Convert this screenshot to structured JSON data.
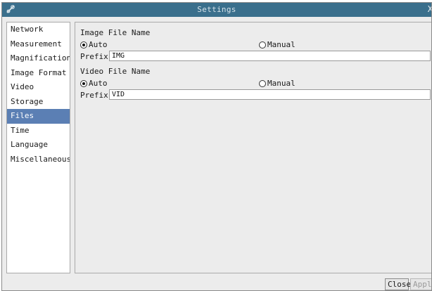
{
  "window": {
    "title": "Settings",
    "app_icon": "tools-icon",
    "close_glyph": "X"
  },
  "sidebar": {
    "items": [
      {
        "label": "Network",
        "active": false
      },
      {
        "label": "Measurement",
        "active": false
      },
      {
        "label": "Magnification",
        "active": false
      },
      {
        "label": "Image Format",
        "active": false
      },
      {
        "label": "Video",
        "active": false
      },
      {
        "label": "Storage",
        "active": false
      },
      {
        "label": "Files",
        "active": true
      },
      {
        "label": "Time",
        "active": false
      },
      {
        "label": "Language",
        "active": false
      },
      {
        "label": "Miscellaneous",
        "active": false
      }
    ]
  },
  "image_file": {
    "heading": "Image File Name",
    "auto_label": "Auto",
    "manual_label": "Manual",
    "selected": "auto",
    "prefix_label": "Prefix:",
    "prefix_value": "IMG"
  },
  "video_file": {
    "heading": "Video File Name",
    "auto_label": "Auto",
    "manual_label": "Manual",
    "selected": "auto",
    "prefix_label": "Prefix:",
    "prefix_value": "VID"
  },
  "footer": {
    "close_label": "Close",
    "apply_label": "Apply"
  },
  "colors": {
    "titlebar": "#3a6f8c",
    "selected_item": "#5b7fb4"
  }
}
